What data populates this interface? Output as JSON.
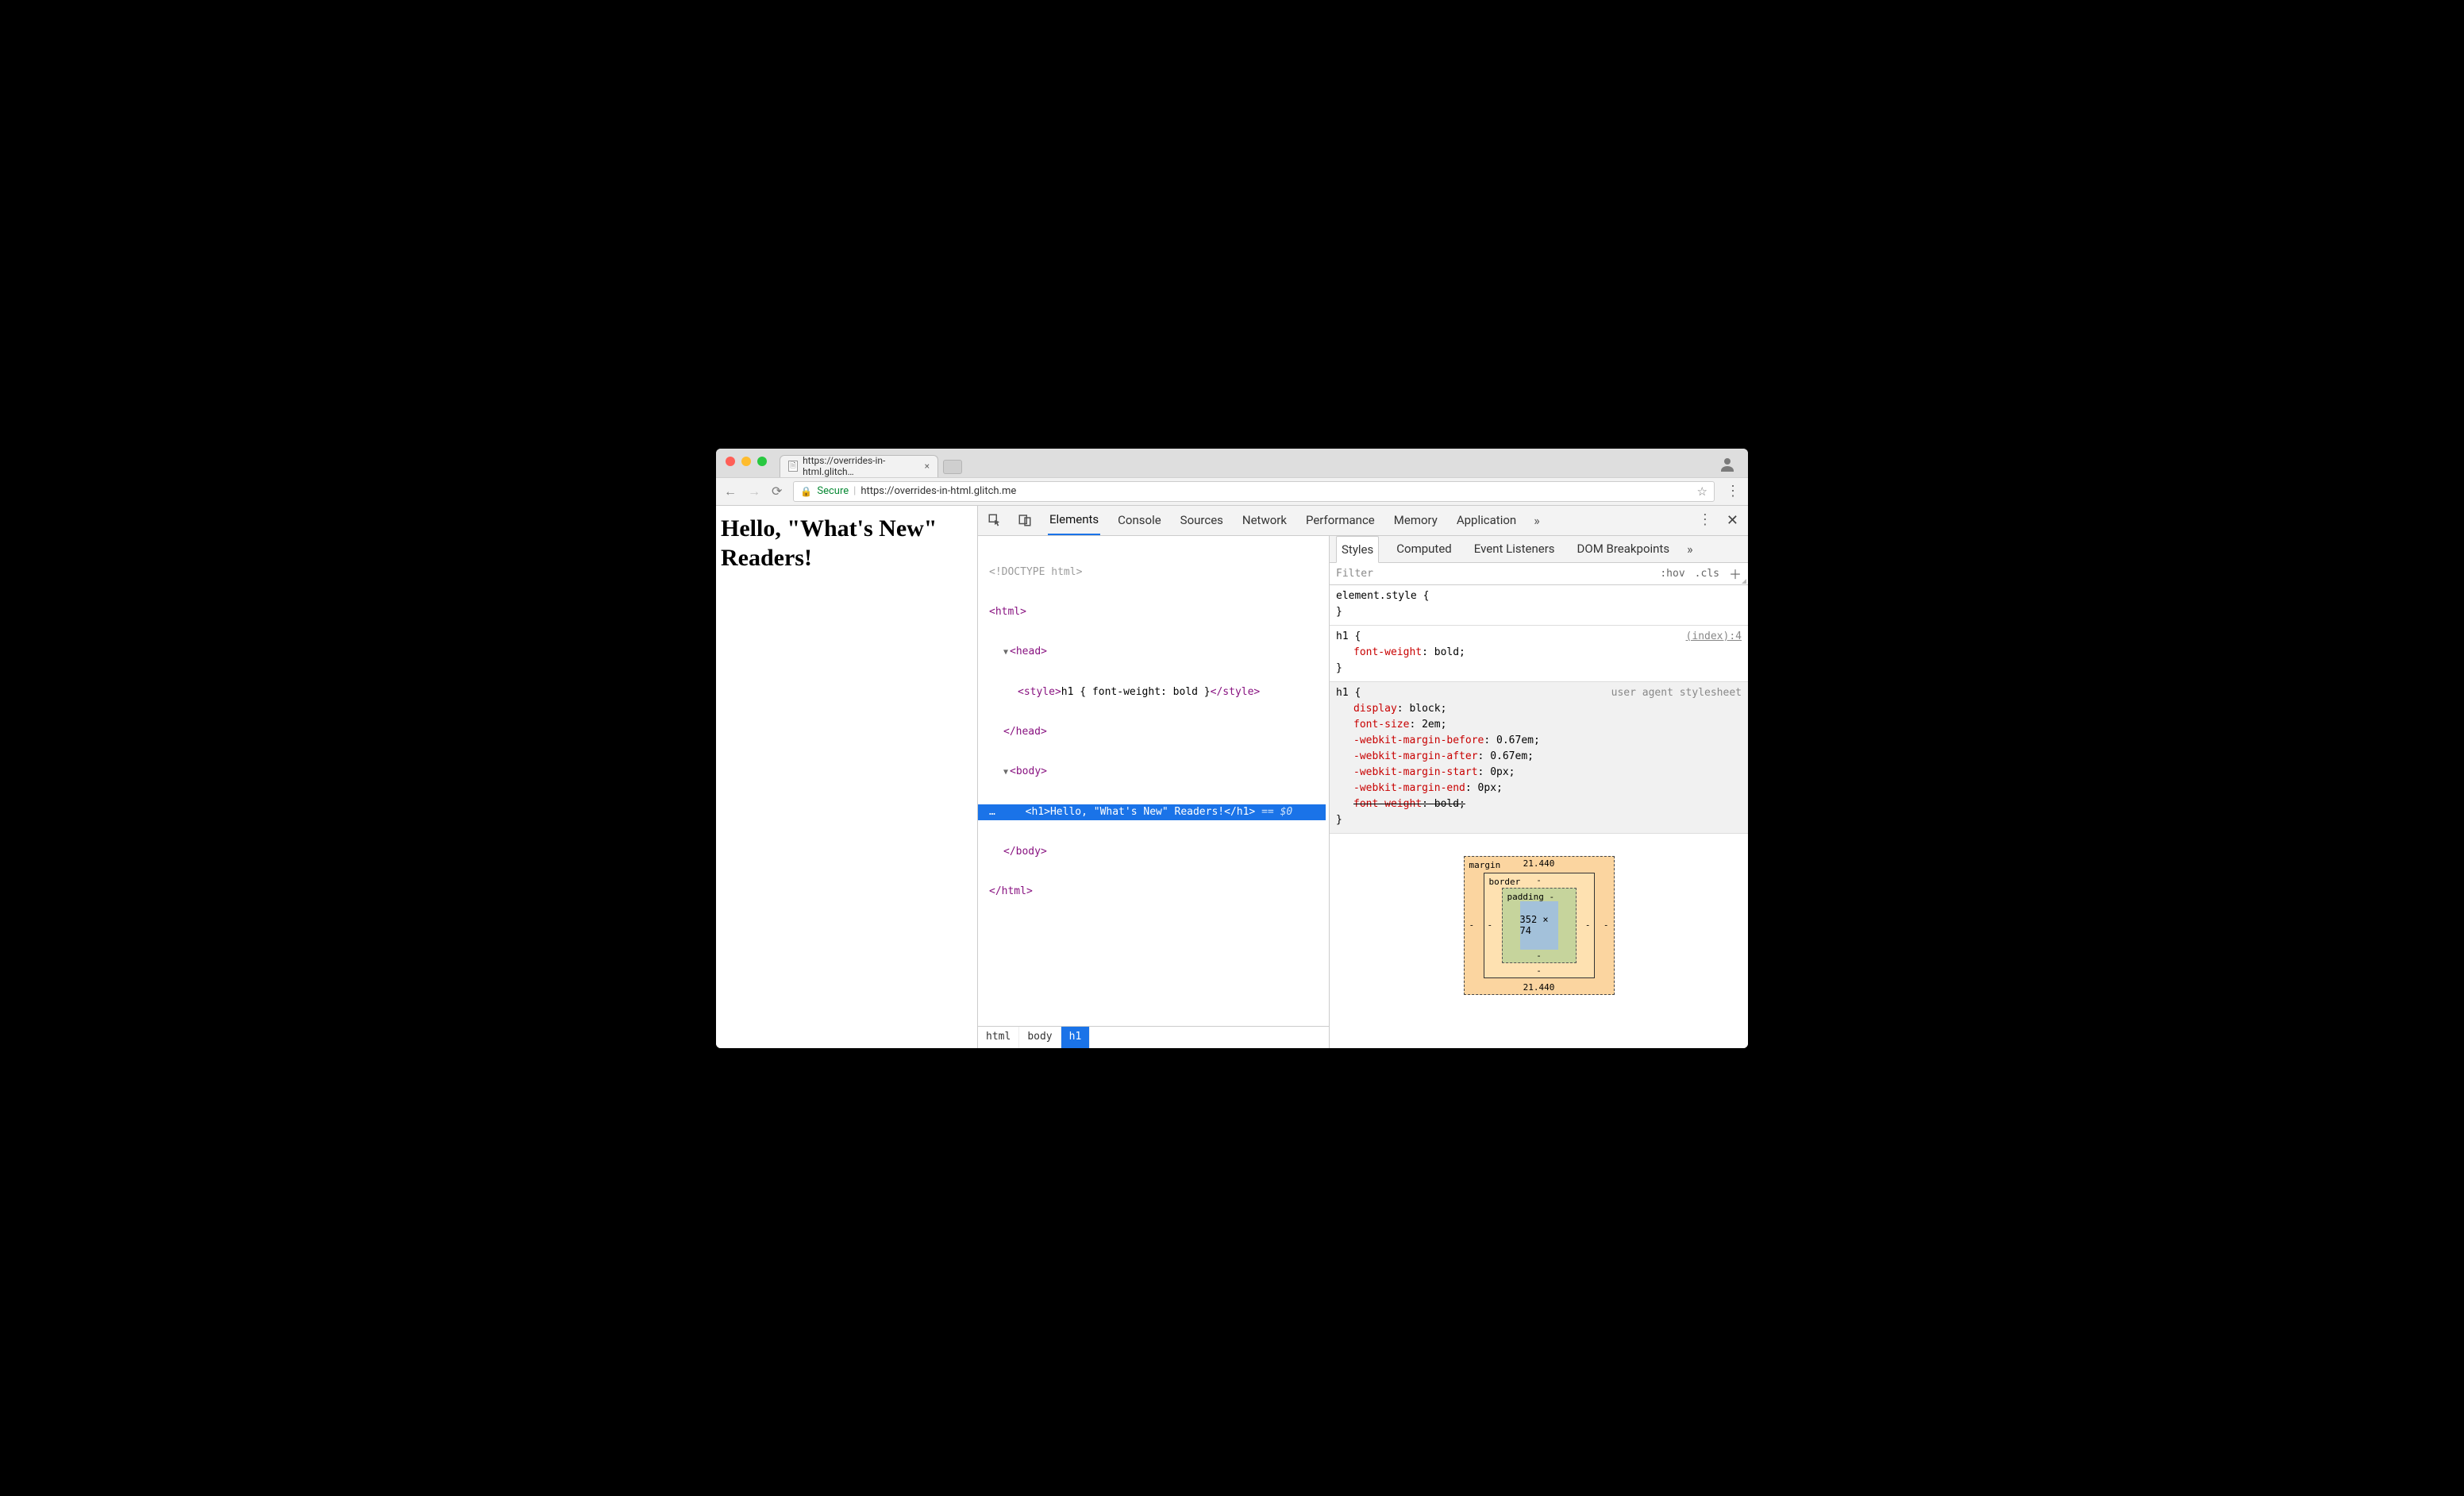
{
  "window": {
    "tab_title": "https://overrides-in-html.glitch…"
  },
  "addressbar": {
    "secure_label": "Secure",
    "url": "https://overrides-in-html.glitch.me"
  },
  "devtools_tabs": [
    "Elements",
    "Console",
    "Sources",
    "Network",
    "Performance",
    "Memory",
    "Application"
  ],
  "devtools_active_tab": "Elements",
  "page_heading": "Hello, \"What's New\" Readers!",
  "dom": {
    "doctype": "<!DOCTYPE html>",
    "html_open": "<html>",
    "head_open": "<head>",
    "style_line_open": "<style>",
    "style_inner": "h1 { font-weight: bold }",
    "style_line_close": "</style>",
    "head_close": "</head>",
    "body_open": "<body>",
    "h1_open": "<h1>",
    "h1_text": "Hello, \"What's New\" Readers!",
    "h1_close": "</h1>",
    "eq_dollar": "== $0",
    "body_close": "</body>",
    "html_close": "</html>",
    "selection_leader": "…"
  },
  "breadcrumbs": [
    "html",
    "body",
    "h1"
  ],
  "styles_panel": {
    "tabs": [
      "Styles",
      "Computed",
      "Event Listeners",
      "DOM Breakpoints"
    ],
    "active_tab": "Styles",
    "filter_placeholder": "Filter",
    "hov": ":hov",
    "cls": ".cls",
    "rules": [
      {
        "selector": "element.style {",
        "declarations": [],
        "source": ""
      },
      {
        "selector": "h1 {",
        "declarations": [
          {
            "prop": "font-weight",
            "value": "bold;"
          }
        ],
        "source": "(index):4",
        "sourceIsLink": true
      },
      {
        "selector": "h1 {",
        "declarations": [
          {
            "prop": "display",
            "value": "block;"
          },
          {
            "prop": "font-size",
            "value": "2em;"
          },
          {
            "prop": "-webkit-margin-before",
            "value": "0.67em;"
          },
          {
            "prop": "-webkit-margin-after",
            "value": "0.67em;"
          },
          {
            "prop": "-webkit-margin-start",
            "value": "0px;"
          },
          {
            "prop": "-webkit-margin-end",
            "value": "0px;"
          },
          {
            "prop": "font-weight",
            "value": "bold;",
            "strike": true
          }
        ],
        "source": "user agent stylesheet",
        "ua": true
      }
    ],
    "close_brace": "}"
  },
  "boxmodel": {
    "margin_label": "margin",
    "margin_top": "21.440",
    "margin_bottom": "21.440",
    "margin_left": "-",
    "margin_right": "-",
    "border_label": "border",
    "border_val": "-",
    "padding_label": "padding -",
    "content": "352 × 74",
    "padding_bottom": "-",
    "border_bottom": "-"
  }
}
